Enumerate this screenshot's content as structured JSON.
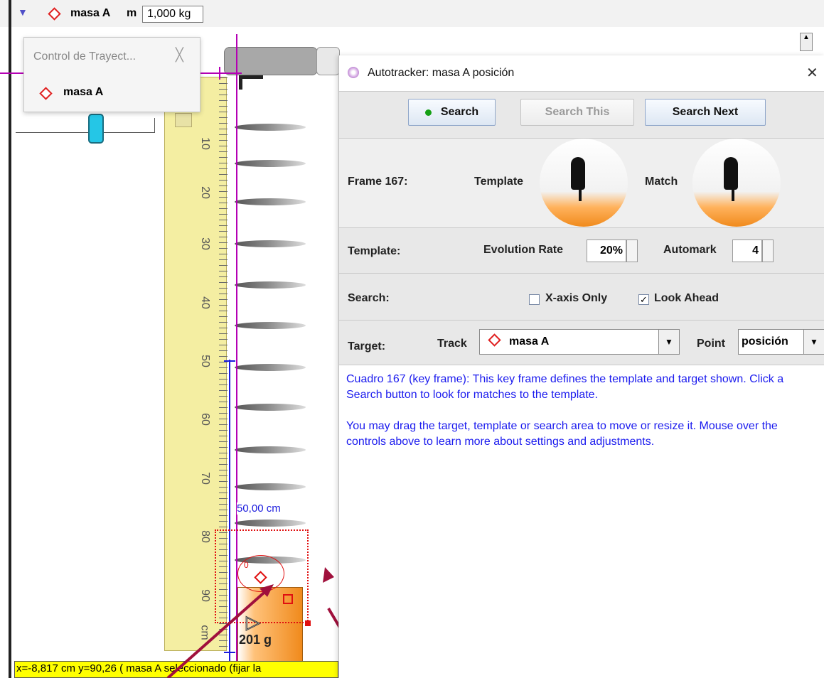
{
  "topbar": {
    "track_name": "masa A",
    "mass_label": "m",
    "mass_value": "1,000 kg"
  },
  "control_popup": {
    "title": "Control de Trayect...",
    "close": "╳",
    "item_label": "masa A"
  },
  "ruler": {
    "ticks": [
      "10",
      "20",
      "30",
      "40",
      "50",
      "60",
      "70",
      "80",
      "90",
      "cm"
    ]
  },
  "video": {
    "distance_label": "50,00 cm",
    "block_label": "201 g",
    "point_marker": "0",
    "status_text": "x=-8,817 cm  y=90,26 ( masa A seleccionado (fijar la"
  },
  "dialog": {
    "title": "Autotracker: masa A posición",
    "close": "✕",
    "buttons": {
      "search": "Search",
      "search_this": "Search This",
      "search_next": "Search Next"
    },
    "frame_label": "Frame 167:",
    "template_img_label": "Template",
    "match_img_label": "Match",
    "template_row": {
      "label": "Template:",
      "evolution_label": "Evolution Rate",
      "evolution_value": "20%",
      "automark_label": "Automark",
      "automark_value": "4"
    },
    "search_row": {
      "label": "Search:",
      "xaxis_label": "X-axis Only",
      "xaxis_checked": false,
      "lookahead_label": "Look Ahead",
      "lookahead_checked": true
    },
    "target_row": {
      "label": "Target:",
      "track_label": "Track",
      "track_value": "masa A",
      "point_label": "Point",
      "point_value": "posición"
    },
    "message_line1": "Cuadro 167 (key frame): This key frame defines the template and target shown. Click a Search button to look for matches to the template.",
    "message_line2": "You may drag the target, template or search area to move or resize it.  Mouse over the controls above to learn more about settings and adjustments."
  },
  "colors": {
    "accent_magenta": "#b400b4",
    "message_blue": "#1a1aee",
    "ruler_yellow": "#f4eea2",
    "arrow_crimson": "#a0103c"
  }
}
